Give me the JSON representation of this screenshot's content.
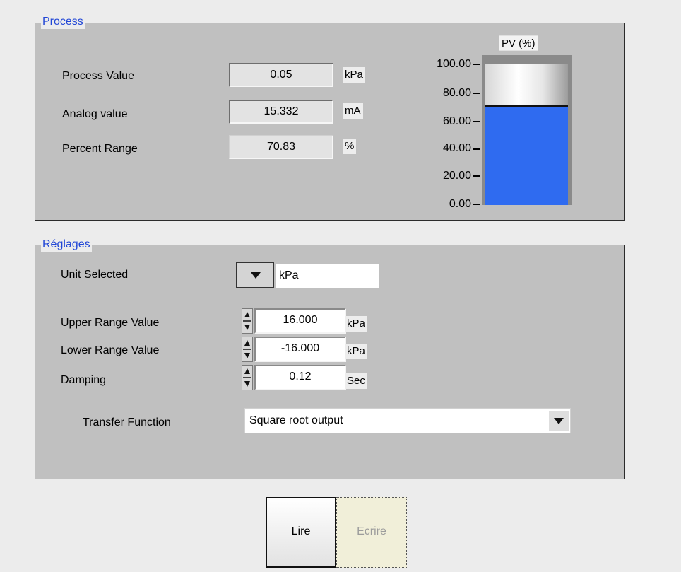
{
  "process": {
    "legend": "Process",
    "rows": [
      {
        "label": "Process Value",
        "value": "0.05",
        "unit": "kPa"
      },
      {
        "label": "Analog value",
        "value": "15.332",
        "unit": "mA"
      },
      {
        "label": "Percent Range",
        "value": "70.83",
        "unit": "%"
      }
    ],
    "gauge": {
      "title": "PV (%)",
      "ticks": [
        "100.00",
        "80.00",
        "60.00",
        "40.00",
        "20.00",
        "0.00"
      ],
      "fill_percent": 70.83,
      "fill_color": "#2f6bf0"
    }
  },
  "settings": {
    "legend": "Réglages",
    "unit_selected": {
      "label": "Unit Selected",
      "value": "kPa"
    },
    "rows": [
      {
        "label": "Upper Range Value",
        "value": "16.000",
        "unit": "kPa"
      },
      {
        "label": "Lower Range Value",
        "value": "-16.000",
        "unit": "kPa"
      },
      {
        "label": "Damping",
        "value": "0.12",
        "unit": "Sec"
      }
    ],
    "transfer_function": {
      "label": "Transfer Function",
      "value": "Square root output"
    }
  },
  "buttons": {
    "read_label": "Lire",
    "write_label": "Ecrire"
  }
}
